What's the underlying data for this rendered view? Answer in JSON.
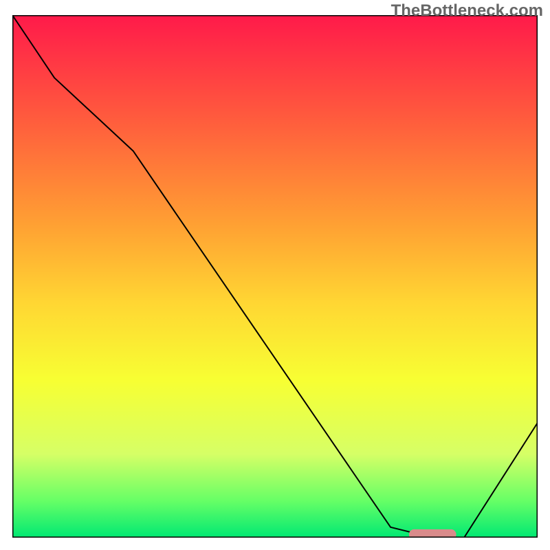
{
  "watermark": "TheBottleneck.com",
  "chart_data": {
    "type": "line",
    "title": "",
    "xlabel": "",
    "ylabel": "",
    "xlim": [
      0,
      100
    ],
    "ylim": [
      0,
      100
    ],
    "grid": false,
    "legend": false,
    "background_gradient": {
      "colors": [
        "#ff1a4a",
        "#ff5c3d",
        "#ffa033",
        "#ffd633",
        "#f7ff33",
        "#d6ff66",
        "#66ff66",
        "#00e873"
      ],
      "stops": [
        0,
        0.2,
        0.4,
        0.55,
        0.7,
        0.84,
        0.93,
        1.0
      ]
    },
    "line": {
      "color": "#000000",
      "width": 2,
      "points_x": [
        0,
        8,
        23,
        72,
        80,
        86,
        100
      ],
      "points_y": [
        100,
        88,
        74,
        2,
        0,
        0,
        22
      ]
    },
    "marker": {
      "shape": "rounded-rect",
      "x": 80,
      "y": 0.6,
      "width_x_units": 9,
      "height_y_units": 2.0,
      "fill": "#d98b8b"
    }
  }
}
